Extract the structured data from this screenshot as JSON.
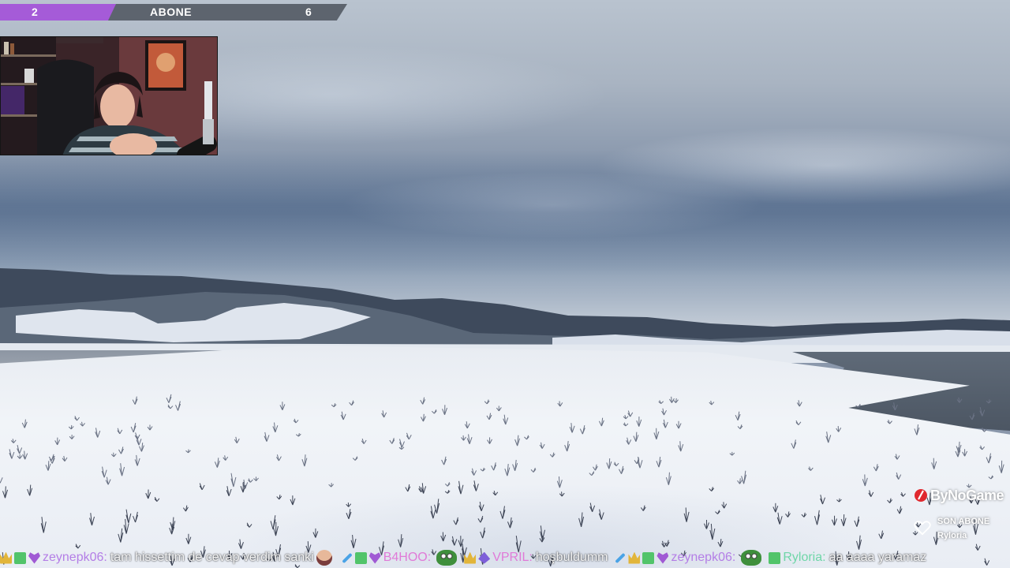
{
  "goal": {
    "current": "2",
    "label": "ABONE",
    "target": "6",
    "progress": 0.333,
    "fill_color": "#a55bd8",
    "track_color": "#5d646e"
  },
  "logo": {
    "text": "ByNoGame",
    "icon": "bynogame-logo-icon",
    "accent": "#e0282e"
  },
  "last_sub": {
    "title": "SON ABONE",
    "name": "Ryloria",
    "icon": "heart-icon"
  },
  "chat": [
    {
      "badges": [
        "crown-badge",
        "sub-badge",
        "heart-badge"
      ],
      "user": "zeynepk06",
      "sep": ":",
      "text": "tam hissettim de cevap verdim sanki",
      "emotes_after": [
        "face-emote"
      ],
      "user_color": "#b47ee6"
    },
    {
      "badges": [
        "sword-badge",
        "sub-badge",
        "heart-badge"
      ],
      "user": "B4HOO",
      "sep": ":",
      "text": "",
      "emotes_after": [
        "frog-emote"
      ],
      "user_color": "#e07ad8"
    },
    {
      "badges": [
        "crown-badge",
        "bits-badge"
      ],
      "user": "VPRIL",
      "sep": ":",
      "text": "hoşbuldumm",
      "emotes_after": [],
      "user_color": "#e07ad8"
    },
    {
      "badges": [
        "sword-badge",
        "crown-badge",
        "sub-badge",
        "heart-badge"
      ],
      "user": "zeynepk06",
      "sep": ":",
      "text": "",
      "emotes_after": [
        "frog-emote"
      ],
      "user_color": "#b47ee6"
    },
    {
      "badges": [
        "sub-badge"
      ],
      "user": "Ryloria",
      "sep": ":",
      "text": "aa aaaa yaramaz",
      "emotes_after": [],
      "user_color": "#6fd6a8"
    }
  ]
}
